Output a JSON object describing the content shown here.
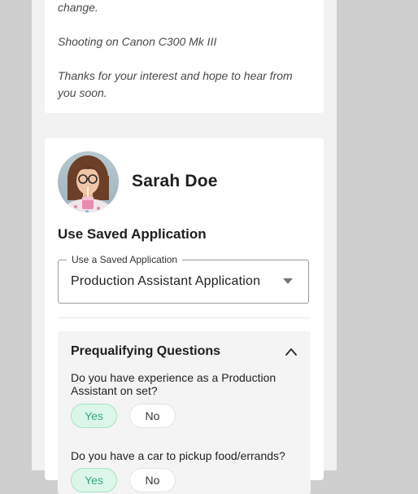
{
  "description_card": {
    "lines": [
      "change.",
      "Shooting on Canon C300 Mk III",
      "Thanks for your interest and hope to hear from you soon."
    ]
  },
  "profile": {
    "name": "Sarah Doe"
  },
  "saved_application": {
    "section_title": "Use Saved Application",
    "field_label": "Use a Saved Application",
    "selected_value": "Production Assistant Application"
  },
  "prequalifying": {
    "title": "Prequalifying Questions",
    "questions": [
      {
        "text": "Do you have experience as a Production Assistant on set?",
        "yes_label": "Yes",
        "no_label": "No",
        "selected": "Yes"
      },
      {
        "text": "Do you have a car to pickup food/errands?",
        "yes_label": "Yes",
        "no_label": "No",
        "selected": "Yes"
      }
    ]
  },
  "colors": {
    "accent_green": "#3aa77b",
    "selected_pill_bg": "#dcf7ea"
  }
}
